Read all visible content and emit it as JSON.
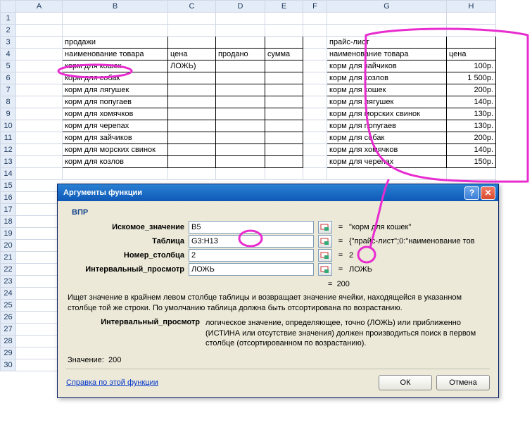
{
  "columns": [
    "A",
    "B",
    "C",
    "D",
    "E",
    "F",
    "G",
    "H"
  ],
  "rows": [
    1,
    2,
    3,
    4,
    5,
    6,
    7,
    8,
    9,
    10,
    11,
    12,
    13,
    14,
    15,
    16,
    17,
    18,
    19,
    20,
    21,
    22,
    23,
    24,
    25,
    26,
    27,
    28,
    29,
    30
  ],
  "left": {
    "title": "продажи",
    "hdr_name": "наименование товара",
    "hdr_price": "цена",
    "hdr_sold": "продано",
    "hdr_sum": "сумма",
    "c5": "ЛОЖЬ)",
    "items": [
      "корм для кошек",
      "корм для собак",
      "корм для лягушек",
      "корм для попугаев",
      "корм для хомячков",
      "корм для черепах",
      "корм для зайчиков",
      "корм для морских свинок",
      "корм для козлов"
    ]
  },
  "right": {
    "title": "прайс-лист",
    "hdr_name": "наименование товара",
    "hdr_price": "цена",
    "rows": [
      {
        "name": "корм для зайчиков",
        "price": "100р."
      },
      {
        "name": "корм для козлов",
        "price": "1 500р."
      },
      {
        "name": "корм для кошек",
        "price": "200р."
      },
      {
        "name": "корм для лягушек",
        "price": "140р."
      },
      {
        "name": "корм для морских свинок",
        "price": "130р."
      },
      {
        "name": "корм для попугаев",
        "price": "130р."
      },
      {
        "name": "корм для собак",
        "price": "200р."
      },
      {
        "name": "корм для хомячков",
        "price": "140р."
      },
      {
        "name": "корм для черепах",
        "price": "150р."
      }
    ]
  },
  "dialog": {
    "title": "Аргументы функции",
    "func": "ВПР",
    "arg1_label": "Искомое_значение",
    "arg1_value": "B5",
    "arg1_result": "\"корм для кошек\"",
    "arg2_label": "Таблица",
    "arg2_value": "G3:H13",
    "arg2_result": "{\"прайс-лист\";0:\"наименование тов",
    "arg3_label": "Номер_столбца",
    "arg3_value": "2",
    "arg3_result": "2",
    "arg4_label": "Интервальный_просмотр",
    "arg4_value": "ЛОЖЬ",
    "arg4_result": "ЛОЖЬ",
    "eq_result": "200",
    "desc": "Ищет значение в крайнем левом столбце таблицы и возвращает значение ячейки, находящейся в указанном столбце той же строки. По умолчанию таблица должна быть отсортирована по возрастанию.",
    "argdesc_name": "Интервальный_просмотр",
    "argdesc_text": "логическое значение, определяющее, точно (ЛОЖЬ) или приближенно (ИСТИНА или отсутствие значения) должен производиться поиск в первом столбце (отсортированном по возрастанию).",
    "result_label": "Значение:",
    "result_value": "200",
    "help_link": "Справка по этой функции",
    "ok": "ОК",
    "cancel": "Отмена",
    "eq": "="
  }
}
